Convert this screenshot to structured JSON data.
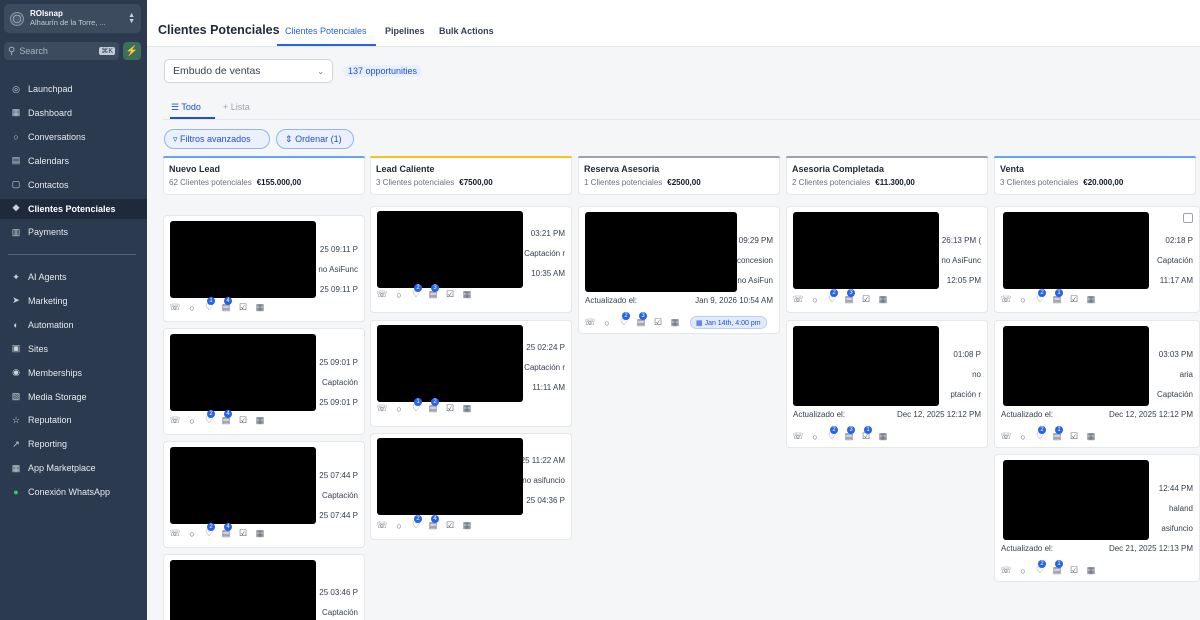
{
  "account": {
    "name": "ROIsnap",
    "location": "Alhaurín de la Torre, ..."
  },
  "search": {
    "placeholder": "Search",
    "shortcut": "⌘K"
  },
  "sidebar": {
    "top_items": [
      {
        "label": "Launchpad",
        "icon": "launchpad-icon"
      },
      {
        "label": "Dashboard",
        "icon": "dashboard-icon"
      },
      {
        "label": "Conversations",
        "icon": "chat-icon"
      },
      {
        "label": "Calendars",
        "icon": "calendar-icon"
      },
      {
        "label": "Contactos",
        "icon": "contacts-icon"
      },
      {
        "label": "Clientes Potenciales",
        "icon": "opportunities-icon",
        "active": true
      },
      {
        "label": "Payments",
        "icon": "payments-icon"
      }
    ],
    "bottom_items": [
      {
        "label": "AI Agents",
        "icon": "sparkle-icon"
      },
      {
        "label": "Marketing",
        "icon": "send-icon"
      },
      {
        "label": "Automation",
        "icon": "automation-icon"
      },
      {
        "label": "Sites",
        "icon": "sites-icon"
      },
      {
        "label": "Memberships",
        "icon": "memberships-icon"
      },
      {
        "label": "Media Storage",
        "icon": "media-icon"
      },
      {
        "label": "Reputation",
        "icon": "star-icon"
      },
      {
        "label": "Reporting",
        "icon": "reporting-icon"
      },
      {
        "label": "App Marketplace",
        "icon": "marketplace-icon"
      },
      {
        "label": "Conexión WhatsApp",
        "icon": "whatsapp-icon"
      }
    ]
  },
  "header": {
    "title": "Clientes Potenciales",
    "tabs": [
      "Clientes Potenciales",
      "Pipelines",
      "Bulk Actions"
    ]
  },
  "toolbar": {
    "pipeline": "Embudo de ventas",
    "opportunities": "137 opportunities",
    "views": [
      "Todo",
      "Lista"
    ],
    "filters_label": "Filtros avanzados",
    "sort_label": "Ordenar (1)"
  },
  "columns": [
    {
      "name": "Nuevo Lead",
      "count": "62 Clientes potenciales",
      "value": "€155.000,00",
      "color": "#60a5fa"
    },
    {
      "name": "Lead Caliente",
      "count": "3 Clientes potenciales",
      "value": "€7500,00",
      "color": "#fbbf24"
    },
    {
      "name": "Reserva Asesoria",
      "count": "1 Clientes potenciales",
      "value": "€2500,00",
      "color": "#9ca3af"
    },
    {
      "name": "Asesoria Completada",
      "count": "2 Clientes potenciales",
      "value": "€11.300,00",
      "color": "#9ca3af"
    },
    {
      "name": "Venta",
      "count": "3 Clientes potenciales",
      "value": "€20.000,00",
      "color": "#60a5fa"
    }
  ],
  "cards": {
    "c1a": {
      "lines": [
        "25 09:11 P",
        "no AsiFunc",
        "25 09:11 P"
      ]
    },
    "c1b": {
      "lines": [
        "25 09:01 P",
        "Captación",
        "25 09:01 P"
      ]
    },
    "c1c": {
      "lines": [
        "25 07:44 P",
        "Captación",
        "25 07:44 P"
      ]
    },
    "c1d": {
      "lines": [
        "25 03:46 P",
        "Captación"
      ]
    },
    "c2a": {
      "lines": [
        "03:21 PM",
        "Captación r",
        "10:35 AM"
      ]
    },
    "c2b": {
      "lines": [
        "25 02:24 P",
        "Captación r",
        "11:11 AM"
      ]
    },
    "c2c": {
      "lines": [
        "25 11:22 AM",
        "no asifuncio",
        "25 04:36 P"
      ]
    },
    "c3a": {
      "lines": [
        "09:29 PM",
        "concesion",
        "no AsiFun"
      ],
      "updated_label": "Actualizado el:",
      "updated_value": "Jan 9, 2026 10:54 AM",
      "appointment": "Jan 14th, 4:00 pm"
    },
    "c4a": {
      "lines": [
        "26:13 PM (",
        "no AsiFunc",
        "12:05 PM"
      ]
    },
    "c4b": {
      "lines": [
        "01:08 P",
        "no",
        "ptación r"
      ],
      "updated_label": "Actualizado el:",
      "updated_value": "Dec 12, 2025 12:12 PM"
    },
    "c5a": {
      "lines": [
        "02:18 P",
        "Captación",
        "11:17 AM"
      ]
    },
    "c5b": {
      "lines": [
        "03:03 PM",
        "aria",
        "Captación"
      ],
      "updated_label": "Actualizado el:",
      "updated_value": "Dec 12, 2025 12:12 PM"
    },
    "c5c": {
      "lines": [
        "12:44 PM",
        "haland",
        "asifuncio"
      ],
      "updated_label": "Actualizado el:",
      "updated_value": "Dec 21, 2025 12:13 PM"
    }
  }
}
